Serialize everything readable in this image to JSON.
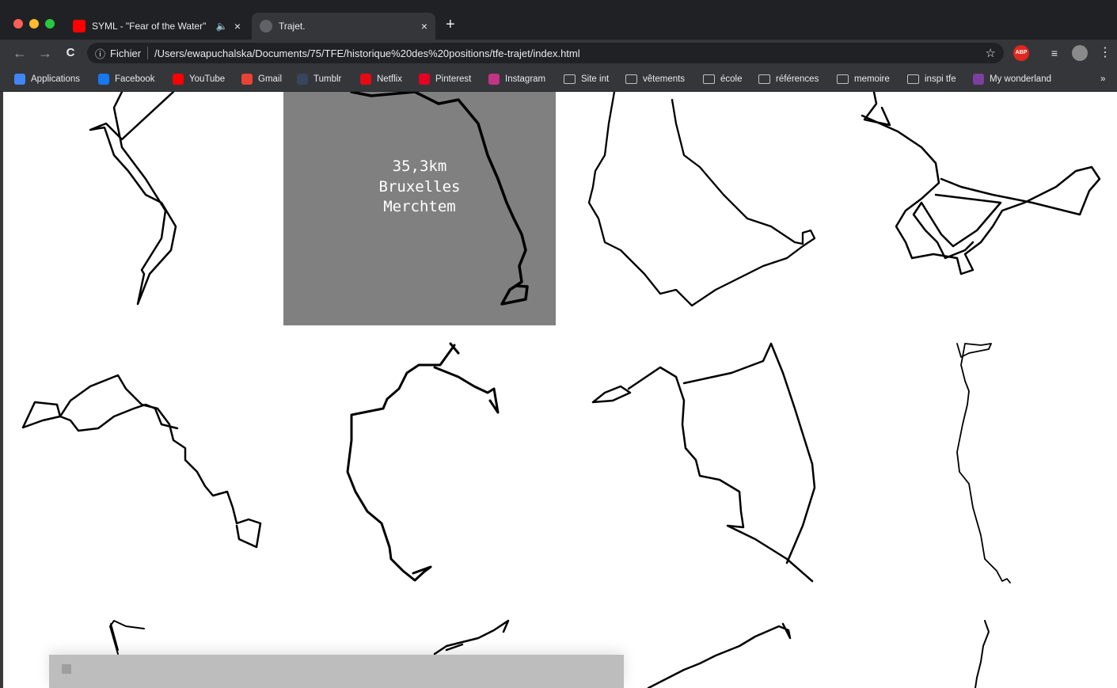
{
  "window": {
    "traffic_lights": [
      {
        "name": "close-dot",
        "color": "#ff5f57"
      },
      {
        "name": "minimize-dot",
        "color": "#febc2e"
      },
      {
        "name": "maximize-dot",
        "color": "#28c840"
      }
    ]
  },
  "tabs": [
    {
      "title": "SYML - \"Fear of the Water\"",
      "audio_icon": "🔈",
      "close": "×",
      "favicon_color": "#ff0000",
      "active": false
    },
    {
      "title": "Trajet.",
      "close": "×",
      "favicon_color": "#5f6368",
      "active": true
    }
  ],
  "new_tab_label": "+",
  "toolbar": {
    "back": "←",
    "forward": "→",
    "reload": "C",
    "info_icon": "ⓘ",
    "scheme_label": "Fichier",
    "url": "/Users/ewapuchalska/Documents/75/TFE/historique%20des%20positions/tfe-trajet/index.html",
    "star": "☆",
    "abp_label": "ABP",
    "menu": "⋮"
  },
  "bookmarks": {
    "items": [
      {
        "label": "Applications",
        "icon": "apps-icon",
        "color": "#4285f4"
      },
      {
        "label": "Facebook",
        "icon": "facebook-icon",
        "color": "#1877f2"
      },
      {
        "label": "YouTube",
        "icon": "youtube-icon",
        "color": "#ff0000"
      },
      {
        "label": "Gmail",
        "icon": "gmail-icon",
        "color": "#ea4335"
      },
      {
        "label": "Tumblr",
        "icon": "tumblr-icon",
        "color": "#36465d"
      },
      {
        "label": "Netflix",
        "icon": "netflix-icon",
        "color": "#e50914"
      },
      {
        "label": "Pinterest",
        "icon": "pinterest-icon",
        "color": "#e60023"
      },
      {
        "label": "Instagram",
        "icon": "instagram-icon",
        "color": "#c13584"
      },
      {
        "label": "Site int",
        "icon": "folder-icon",
        "color": "#bdc1c6"
      },
      {
        "label": "vêtements",
        "icon": "folder-icon",
        "color": "#bdc1c6"
      },
      {
        "label": "école",
        "icon": "folder-icon",
        "color": "#bdc1c6"
      },
      {
        "label": "références",
        "icon": "folder-icon",
        "color": "#bdc1c6"
      },
      {
        "label": "memoire",
        "icon": "folder-icon",
        "color": "#bdc1c6"
      },
      {
        "label": "inspi tfe",
        "icon": "folder-icon",
        "color": "#bdc1c6"
      },
      {
        "label": "My wonderland",
        "icon": "wonderland-icon",
        "color": "#7b3fa0"
      }
    ],
    "overflow": "»"
  },
  "page": {
    "highlight": {
      "distance": "35,3km",
      "from": "Bruxelles",
      "to": "Merchtem",
      "background": "#808080"
    },
    "track_color": "#000000"
  }
}
